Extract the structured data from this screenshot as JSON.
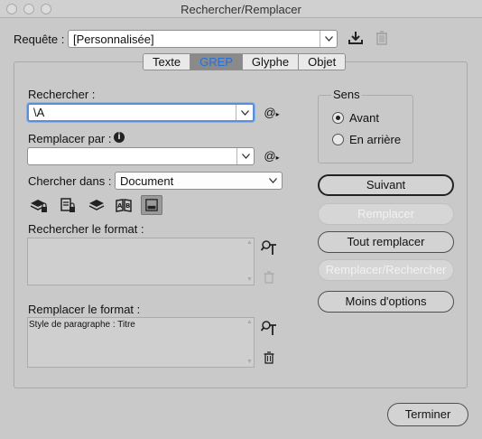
{
  "window": {
    "title": "Rechercher/Remplacer"
  },
  "query": {
    "label": "Requête :",
    "value": "[Personnalisée]"
  },
  "tabs": [
    {
      "label": "Texte",
      "active": false
    },
    {
      "label": "GREP",
      "active": true
    },
    {
      "label": "Glyphe",
      "active": false
    },
    {
      "label": "Objet",
      "active": false
    }
  ],
  "search": {
    "label": "Rechercher :",
    "value": "\\A"
  },
  "replace": {
    "label": "Remplacer par :",
    "value": ""
  },
  "search_in": {
    "label": "Chercher dans :",
    "value": "Document"
  },
  "find_format": {
    "label": "Rechercher le format :",
    "value": ""
  },
  "replace_format": {
    "label": "Remplacer le format :",
    "value": "Style de paragraphe : Titre"
  },
  "direction": {
    "label": "Sens",
    "options": [
      {
        "label": "Avant",
        "selected": true
      },
      {
        "label": "En arrière",
        "selected": false
      }
    ]
  },
  "buttons": {
    "next": "Suivant",
    "replace": "Remplacer",
    "replace_all": "Tout remplacer",
    "replace_find": "Remplacer/Rechercher",
    "fewer_options": "Moins d'options",
    "done": "Terminer"
  },
  "colors": {
    "accent": "#2a6fd6",
    "focus": "#5b8fdc",
    "background": "#c9c9c9"
  }
}
